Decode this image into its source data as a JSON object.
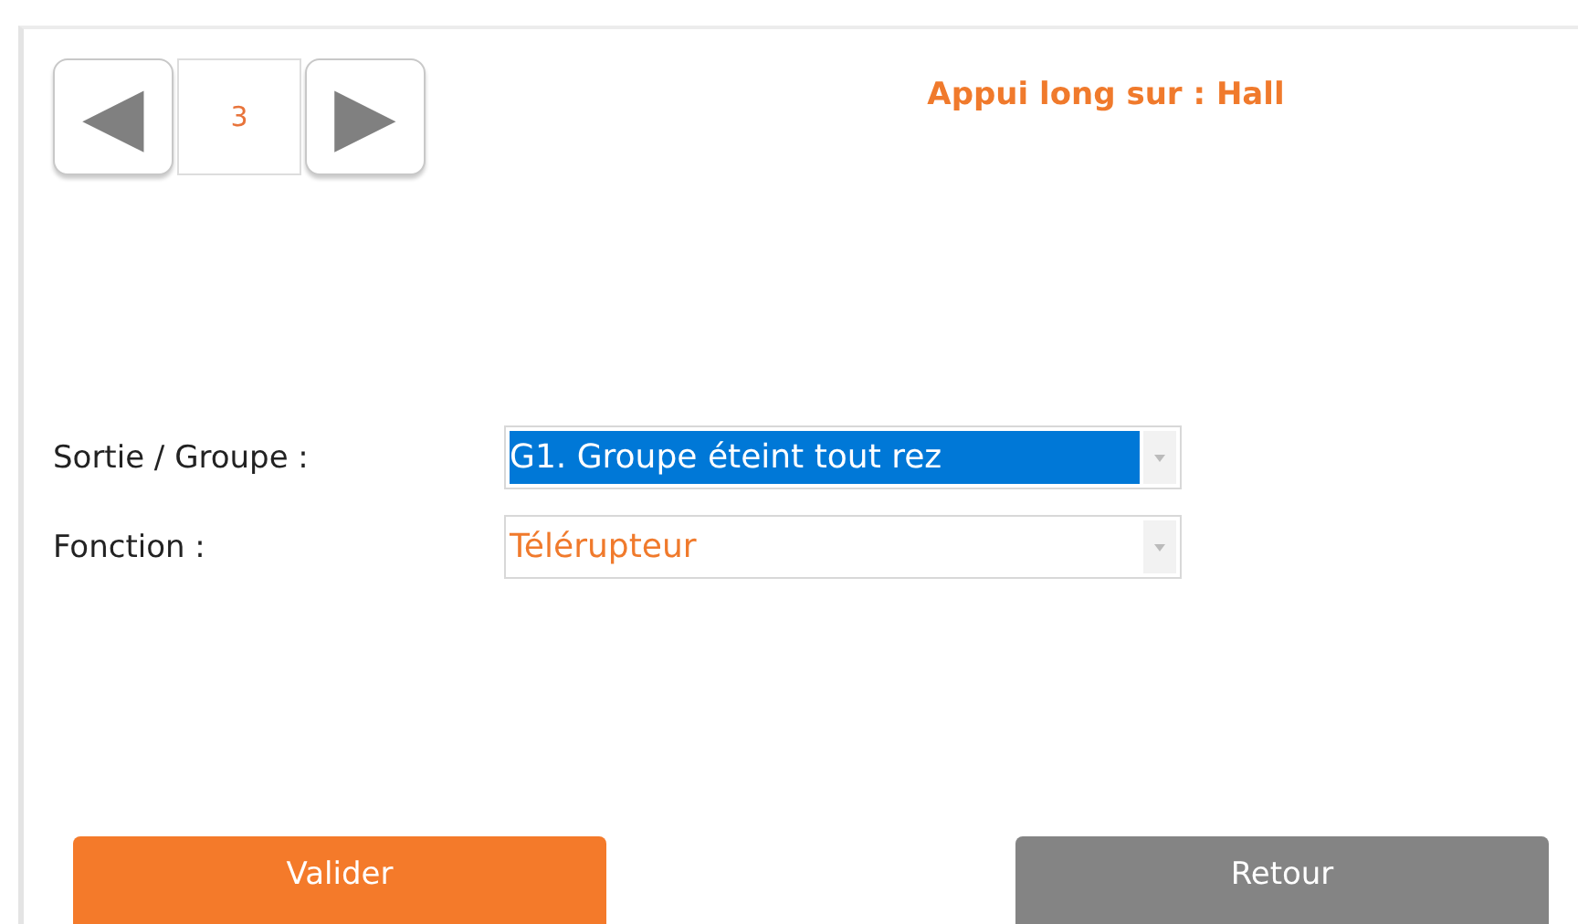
{
  "pager": {
    "previous": "◀",
    "page": "3",
    "next": "▶"
  },
  "title": "Appui long sur : Hall",
  "fields": [
    {
      "label": "Sortie / Groupe :",
      "value": "G1. Groupe éteint tout rez",
      "highlighted": true
    },
    {
      "label": "Fonction :",
      "value": "Télérupteur",
      "highlighted": false
    }
  ],
  "buttons": [
    {
      "label": "Valider",
      "kind": "primary"
    },
    {
      "label": "Retour",
      "kind": "secondary"
    }
  ]
}
